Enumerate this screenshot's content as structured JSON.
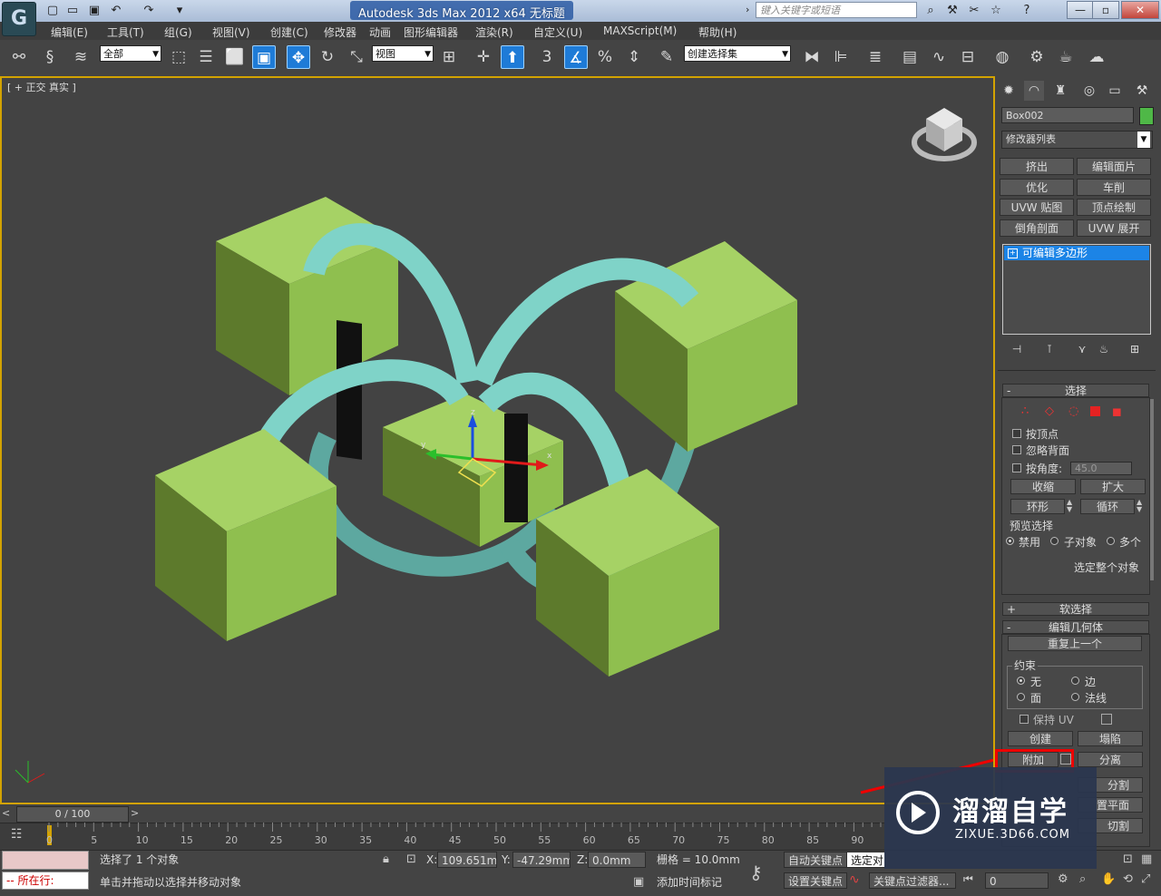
{
  "app": {
    "logo": "G",
    "title": "Autodesk 3ds Max  2012 x64      无标题",
    "search_placeholder": "键入关键字或短语",
    "quick_access": [
      "new-icon",
      "open-icon",
      "save-icon",
      "undo-icon",
      "redo-icon",
      "dropdown-icon"
    ],
    "window_buttons": [
      "—",
      "▫",
      "✕"
    ]
  },
  "menu": [
    "编辑(E)",
    "工具(T)",
    "组(G)",
    "视图(V)",
    "创建(C)",
    "修改器",
    "动画",
    "图形编辑器",
    "渲染(R)",
    "自定义(U)",
    "MAXScript(M)",
    "帮助(H)"
  ],
  "toolbar": {
    "selection_filter": "全部",
    "reference_coord": "视图",
    "named_selection": "创建选择集",
    "snap_label": "3"
  },
  "viewport": {
    "label": "[ + ] 正交 ] 真实 ]",
    "label_parts": [
      "[ +",
      "正交",
      "真实 ]"
    ],
    "gizmo_axes": [
      "x",
      "y",
      "z"
    ],
    "colors": {
      "box": "#8fbf4f",
      "torus": "#7fd3c8",
      "background": "#434343",
      "active_border": "#d3a300"
    }
  },
  "command_panel": {
    "object_name": "Box002",
    "object_color": "#4fb847",
    "modifier_list": "修改器列表",
    "modifier_buttons": [
      "挤出",
      "编辑面片",
      "优化",
      "车削",
      "UVW 贴图",
      "顶点绘制",
      "倒角剖面",
      "UVW 展开"
    ],
    "stack_item": "可编辑多边形",
    "selection": {
      "header": "选择",
      "by_vertex": "按顶点",
      "ignore_backfacing": "忽略背面",
      "by_angle": "按角度:",
      "angle_value": "45.0",
      "shrink": "收缩",
      "grow": "扩大",
      "ring": "环形",
      "loop": "循环",
      "preview_label": "预览选择",
      "preview_options": [
        "禁用",
        "子对象",
        "多个"
      ],
      "select_whole": "选定整个对象"
    },
    "soft_selection": "软选择",
    "edit_geometry": {
      "header": "编辑几何体",
      "repeat_last": "重复上一个",
      "constraints_label": "约束",
      "constraints": [
        "无",
        "边",
        "面",
        "法线"
      ],
      "preserve_uv": "保持 UV",
      "create": "创建",
      "collapse": "塌陷",
      "attach": "附加",
      "detach": "分离",
      "slice_plane_partial": "分割",
      "slice_plane": "置平面",
      "cut": "切割"
    }
  },
  "timeline": {
    "frame": "0 / 100",
    "ticks": [
      "0",
      "5",
      "10",
      "15",
      "20",
      "25",
      "30",
      "35",
      "40",
      "45",
      "50",
      "55",
      "60",
      "65",
      "70",
      "75",
      "80",
      "85",
      "90"
    ]
  },
  "status": {
    "maxscript_label": "所在行:",
    "selected": "选择了 1 个对象",
    "prompt": "单击并拖动以选择并移动对象",
    "x_label": "X:",
    "x_value": "109.651mm",
    "y_label": "Y:",
    "y_value": "-47.29mm",
    "z_label": "Z:",
    "z_value": "0.0mm",
    "grid": "栅格 = 10.0mm",
    "add_time_tag": "添加时间标记",
    "auto_key": "自动关键点",
    "set_key": "设置关键点",
    "selected_filter": "选定对",
    "key_filters": "关键点过滤器...",
    "frame_value": "0"
  },
  "watermark": {
    "name": "溜溜自学",
    "url": "ZIXUE.3D66.COM"
  }
}
